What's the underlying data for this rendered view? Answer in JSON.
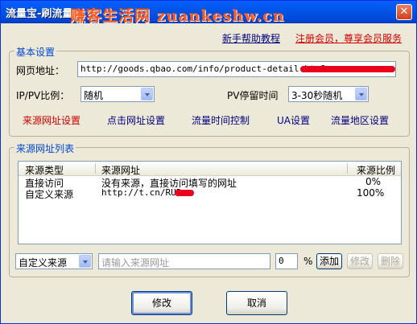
{
  "window": {
    "title": "流量宝-刷流量",
    "watermark": "赚客生活网 zuankeshw.cn",
    "close_glyph": "✕"
  },
  "top_links": {
    "help": "新手帮助教程",
    "register": "注册会员，尊享会员服务"
  },
  "basic": {
    "group_title": "基本设置",
    "url_label": "网页地址：",
    "url_value": "http://goods.qbao.com/info/product-detail.htm?",
    "ratio_label": "IP/PV比例：",
    "ratio_value": "随机",
    "stay_label": "PV停留时间",
    "stay_value": "3-30秒随机",
    "settings_links": [
      "来源网址设置",
      "点击网址设置",
      "流量时间控制",
      "UA设置",
      "流量地区设置"
    ]
  },
  "source": {
    "group_title": "来源网址列表",
    "columns": [
      "来源类型",
      "来源网址",
      "来源比例"
    ],
    "rows": [
      {
        "type": "直接访问",
        "url": "没有来源，直接访问填写的网址",
        "ratio": "0%"
      },
      {
        "type": "自定义来源",
        "url": "http://t.cn/RUR",
        "ratio": "100%"
      }
    ],
    "type_select": "自定义来源",
    "url_placeholder": "请输入来源网址",
    "ratio_input": "0",
    "percent": "%",
    "add": "添加",
    "modify": "修改",
    "delete": "删除"
  },
  "footer": {
    "modify": "修改",
    "cancel": "取消"
  },
  "colors": {
    "accent": "#0046d5",
    "link_red": "#d40000",
    "link_blue": "#000080",
    "titlebar": "#0256e9"
  }
}
